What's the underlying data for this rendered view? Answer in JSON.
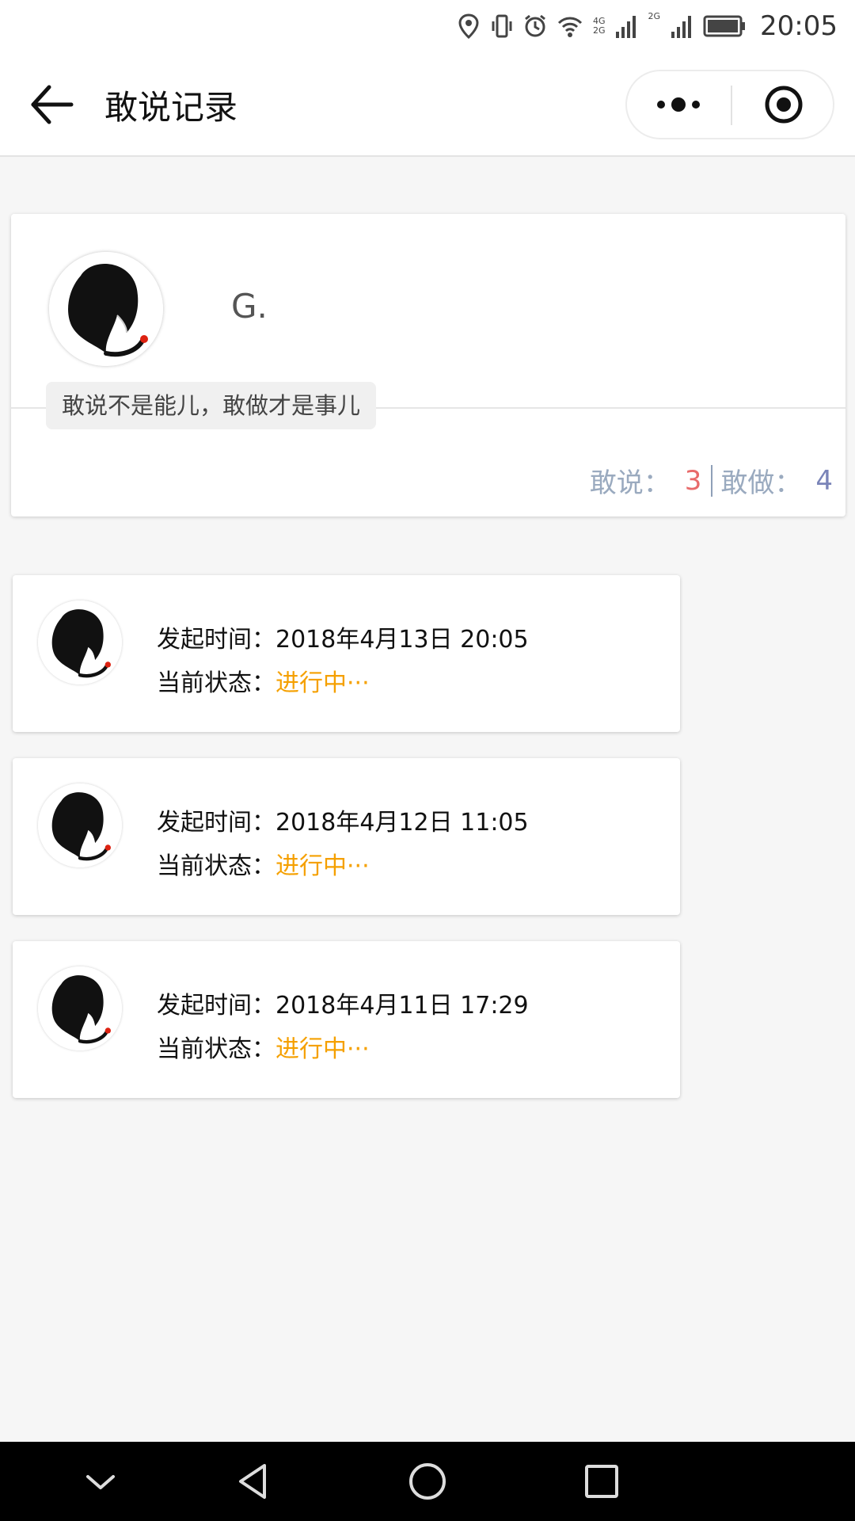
{
  "status_bar": {
    "time": "20:05",
    "network_4g": "4G",
    "network_2g": "2G",
    "network_2g_b": "2G"
  },
  "nav": {
    "title": "敢说记录"
  },
  "profile": {
    "name": "G.",
    "motto": "敢说不是能儿，敢做才是事儿",
    "say_label": "敢说：",
    "say_count": "3",
    "do_label": "敢做：",
    "do_count": "4"
  },
  "records": [
    {
      "time_label": "发起时间：",
      "time": "2018年4月13日 20:05",
      "status_label": "当前状态：",
      "status": "进行中···"
    },
    {
      "time_label": "发起时间：",
      "time": "2018年4月12日 11:05",
      "status_label": "当前状态：",
      "status": "进行中···"
    },
    {
      "time_label": "发起时间：",
      "time": "2018年4月11日 17:29",
      "status_label": "当前状态：",
      "status": "进行中···"
    }
  ],
  "colors": {
    "status_active": "#f5a000",
    "say_count": "#e86a6a",
    "do_count": "#7a84b8",
    "stat_label": "#9aaabf"
  }
}
